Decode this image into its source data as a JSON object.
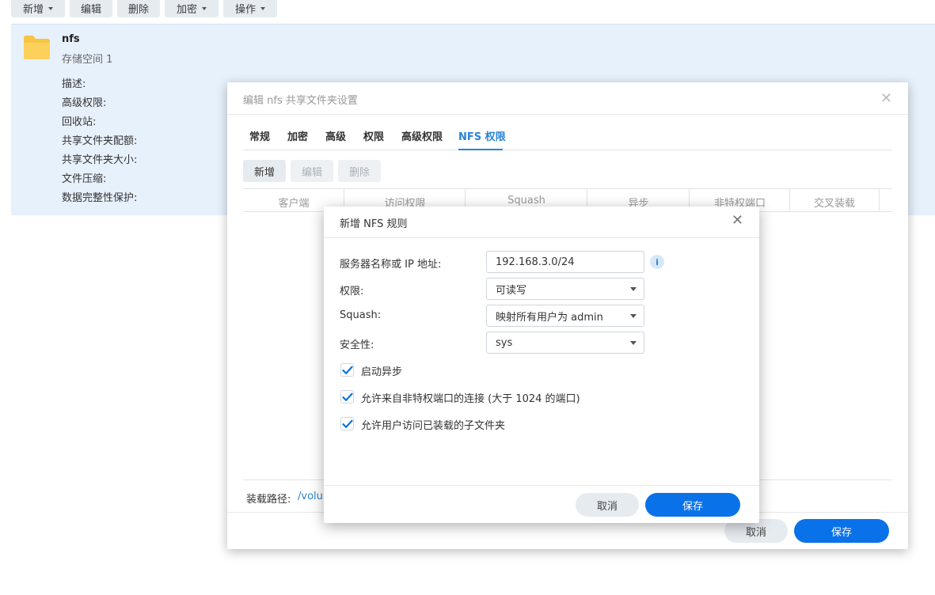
{
  "toolbar": {
    "create_label": "新增",
    "edit_label": "编辑",
    "delete_label": "删除",
    "encrypt_label": "加密",
    "action_label": "操作"
  },
  "share": {
    "name": "nfs",
    "volume": "存储空间 1",
    "labels": [
      "描述:",
      "高级权限:",
      "回收站:",
      "共享文件夹配额:",
      "共享文件夹大小:",
      "文件压缩:",
      "数据完整性保护:"
    ]
  },
  "edit_dialog": {
    "title": "编辑 nfs 共享文件夹设置",
    "close_icon": "close-icon",
    "tabs": [
      "常规",
      "加密",
      "高级",
      "权限",
      "高级权限",
      "NFS 权限"
    ],
    "active_tab": "NFS 权限",
    "buttons": {
      "create": "新增",
      "edit": "编辑",
      "delete": "删除"
    },
    "columns": [
      "客户端",
      "访问权限",
      "Squash",
      "异步",
      "非特权端口",
      "交叉装载"
    ],
    "mount_label": "装载路径:",
    "mount_path": "/volu",
    "cancel_label": "取消",
    "save_label": "保存"
  },
  "nfs_rule_dialog": {
    "title": "新增 NFS 规则",
    "fields": {
      "host_label": "服务器名称或 IP 地址:",
      "host_value": "192.168.3.0/24",
      "privilege_label": "权限:",
      "privilege_value": "可读写",
      "squash_label": "Squash:",
      "squash_value": "映射所有用户为 admin",
      "security_label": "安全性:",
      "security_value": "sys"
    },
    "checkboxes": [
      {
        "label": "启动异步",
        "checked": true
      },
      {
        "label": "允许来自非特权端口的连接 (大于 1024 的端口)",
        "checked": true
      },
      {
        "label": "允许用户访问已装载的子文件夹",
        "checked": true
      }
    ],
    "cancel_label": "取消",
    "save_label": "保存"
  },
  "colors": {
    "accent": "#0a72e8",
    "tab_active": "#2a83d6",
    "selection_bg": "#e7f1fb",
    "folder": "#f8c444"
  }
}
